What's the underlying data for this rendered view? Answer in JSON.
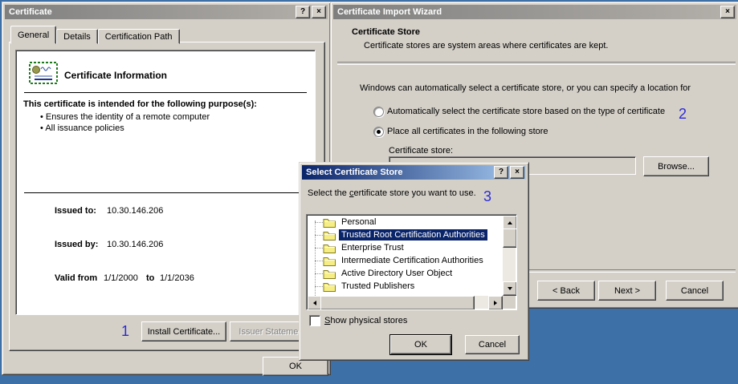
{
  "colors": {
    "desktop": "#3D70A6",
    "dialog_face": "#D4D0C8",
    "active_title_start": "#0A246A",
    "active_title_end": "#A6CAF0",
    "inactive_title_start": "#7F7F7F",
    "inactive_title_end": "#B4B0AA",
    "selection": "#0A246A",
    "annotation": "#2B2BD6"
  },
  "annotations": {
    "step1": "1",
    "step2": "2",
    "step3": "3"
  },
  "glyphs": {
    "help": "?",
    "close": "×"
  },
  "certificate_dialog": {
    "title": "Certificate",
    "tabs": [
      {
        "label": "General",
        "active": true
      },
      {
        "label": "Details",
        "active": false
      },
      {
        "label": "Certification Path",
        "active": false
      }
    ],
    "info_heading": "Certificate Information",
    "purpose_heading": "This certificate is intended for the following purpose(s):",
    "purposes": [
      "Ensures the identity of a remote computer",
      "All issuance policies"
    ],
    "issued_to_label": "Issued to:",
    "issued_to": "10.30.146.206",
    "issued_by_label": "Issued by:",
    "issued_by": "10.30.146.206",
    "valid_label": "Valid from",
    "valid_from": "1/1/2000",
    "valid_to_label": "to",
    "valid_to": "1/1/2036",
    "install_button": "Install Certificate...",
    "issuer_statement_button": "Issuer Statement",
    "ok_button": "OK"
  },
  "import_wizard": {
    "title": "Certificate Import Wizard",
    "page_title": "Certificate Store",
    "page_subtitle": "Certificate stores are system areas where certificates are kept.",
    "intro": "Windows can automatically select a certificate store, or you can specify a location for",
    "radio_auto": {
      "label": "Automatically select the certificate store based on the type of certificate",
      "selected": false
    },
    "radio_place": {
      "label": "Place all certificates in the following store",
      "selected": true
    },
    "store_label": "Certificate store:",
    "store_value": "",
    "browse_button": "Browse...",
    "back_button": "< Back",
    "next_button": "Next >",
    "cancel_button": "Cancel"
  },
  "store_dialog": {
    "title": "Select Certificate Store",
    "instruction": {
      "pre": "Select the ",
      "mnemonic": "c",
      "post": "ertificate store you want to use."
    },
    "tree": {
      "items": [
        {
          "label": "Personal",
          "selected": false
        },
        {
          "label": "Trusted Root Certification Authorities",
          "selected": true
        },
        {
          "label": "Enterprise Trust",
          "selected": false
        },
        {
          "label": "Intermediate Certification Authorities",
          "selected": false
        },
        {
          "label": "Active Directory User Object",
          "selected": false
        },
        {
          "label": "Trusted Publishers",
          "selected": false
        }
      ]
    },
    "show_physical": {
      "pre": "",
      "mnemonic": "S",
      "post": "how physical stores",
      "checked": false
    },
    "ok_button": "OK",
    "cancel_button": "Cancel"
  }
}
